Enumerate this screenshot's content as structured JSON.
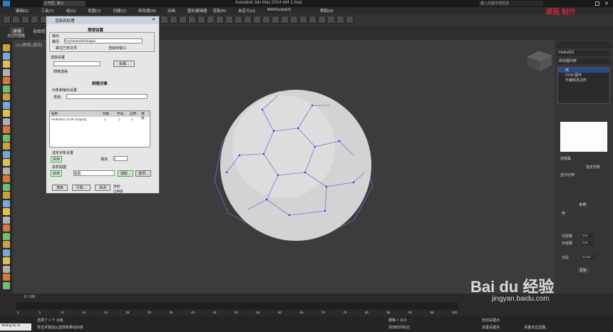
{
  "window": {
    "title": "Autodesk 3ds Max  2014 x64     1.max",
    "workspace": "工作区: 默认",
    "search": "键入关键字或短语"
  },
  "menu": [
    "编辑(E)",
    "工具(T)",
    "组(G)",
    "视图(V)",
    "创建(C)",
    "修改器(M)",
    "动画",
    "图形编辑器",
    "渲染(R)",
    "自定义(U)",
    "MAXScript(X)",
    "帮助(H)"
  ],
  "ribbon": {
    "tabs": [
      "建模",
      "自由形式"
    ],
    "sub": "多边形建模"
  },
  "viewport": {
    "label": "[+] [透视] [真实]"
  },
  "command_panel": {
    "object_name": "Hedra001",
    "modifier_list_label": "修改器列表",
    "stack": [
      "壳",
      "UVW 展开",
      "可编辑多边形"
    ],
    "btn_select": "选择集",
    "btn_assign": "指定列表",
    "rollout_select": "显示切换",
    "rollout_params": "参数",
    "params": {
      "p1": "壳",
      "p2": "内部量",
      "v1": "0.0",
      "p3": "外部量",
      "v2": "0.0",
      "p4": "分段",
      "v3": "0.127",
      "label4": "更新"
    }
  },
  "dialog": {
    "title": "渲染到纹理",
    "sec_general": "常规设置",
    "output_label": "输出",
    "path_label": "路径",
    "path_value": "\\\\sceneassets\\images",
    "skip_existing": "跳过已存文件",
    "render_frame": "渲染帧窗口",
    "render_settings": "渲染设置",
    "settings_btn": "设置...",
    "net_render": "网络渲染",
    "sec_objects": "烘焙对象",
    "bake_config": "对象和输出设置",
    "bake_mode": "烘焙:",
    "cols": [
      "名称",
      "对象...",
      "手动...",
      "启用...",
      "烘焙..."
    ],
    "row": [
      "Hedra001 (0:00 Outputs)",
      "1",
      "1",
      "2",
      ""
    ],
    "sel_label": "选定对象设置",
    "enabled_label": "启用",
    "padding_label": "填充:",
    "padding_value": "2",
    "proj_label": "投影贴图",
    "proj_enabled": "启用",
    "proj_method": "投影",
    "pick_btn": "选取...",
    "options_btn": "选项...",
    "footer": [
      "渲染",
      "行影...",
      "关闭",
      "原始:"
    ],
    "footer_extra": "已烘焙"
  },
  "status": {
    "sel": "选择了 1 个 对象",
    "hint": "单击并拖动以选择和移动对象",
    "add_time": "添加时间标记",
    "auto_key": "自动关键点",
    "set_key": "设置关键点",
    "filter": "关键点过滤器...",
    "grid": "栅格 = 10.0",
    "timeline": "0 / 100",
    "typing": "Texting for AI"
  },
  "watermark": {
    "logo": "Bai du 经验",
    "url": "jingyan.baidu.com",
    "brand": "课程 制作"
  },
  "ticks": [
    "0",
    "5",
    "10",
    "15",
    "20",
    "25",
    "30",
    "35",
    "40",
    "45",
    "50",
    "55",
    "60",
    "65",
    "70",
    "75",
    "80",
    "85",
    "90",
    "95",
    "100"
  ]
}
